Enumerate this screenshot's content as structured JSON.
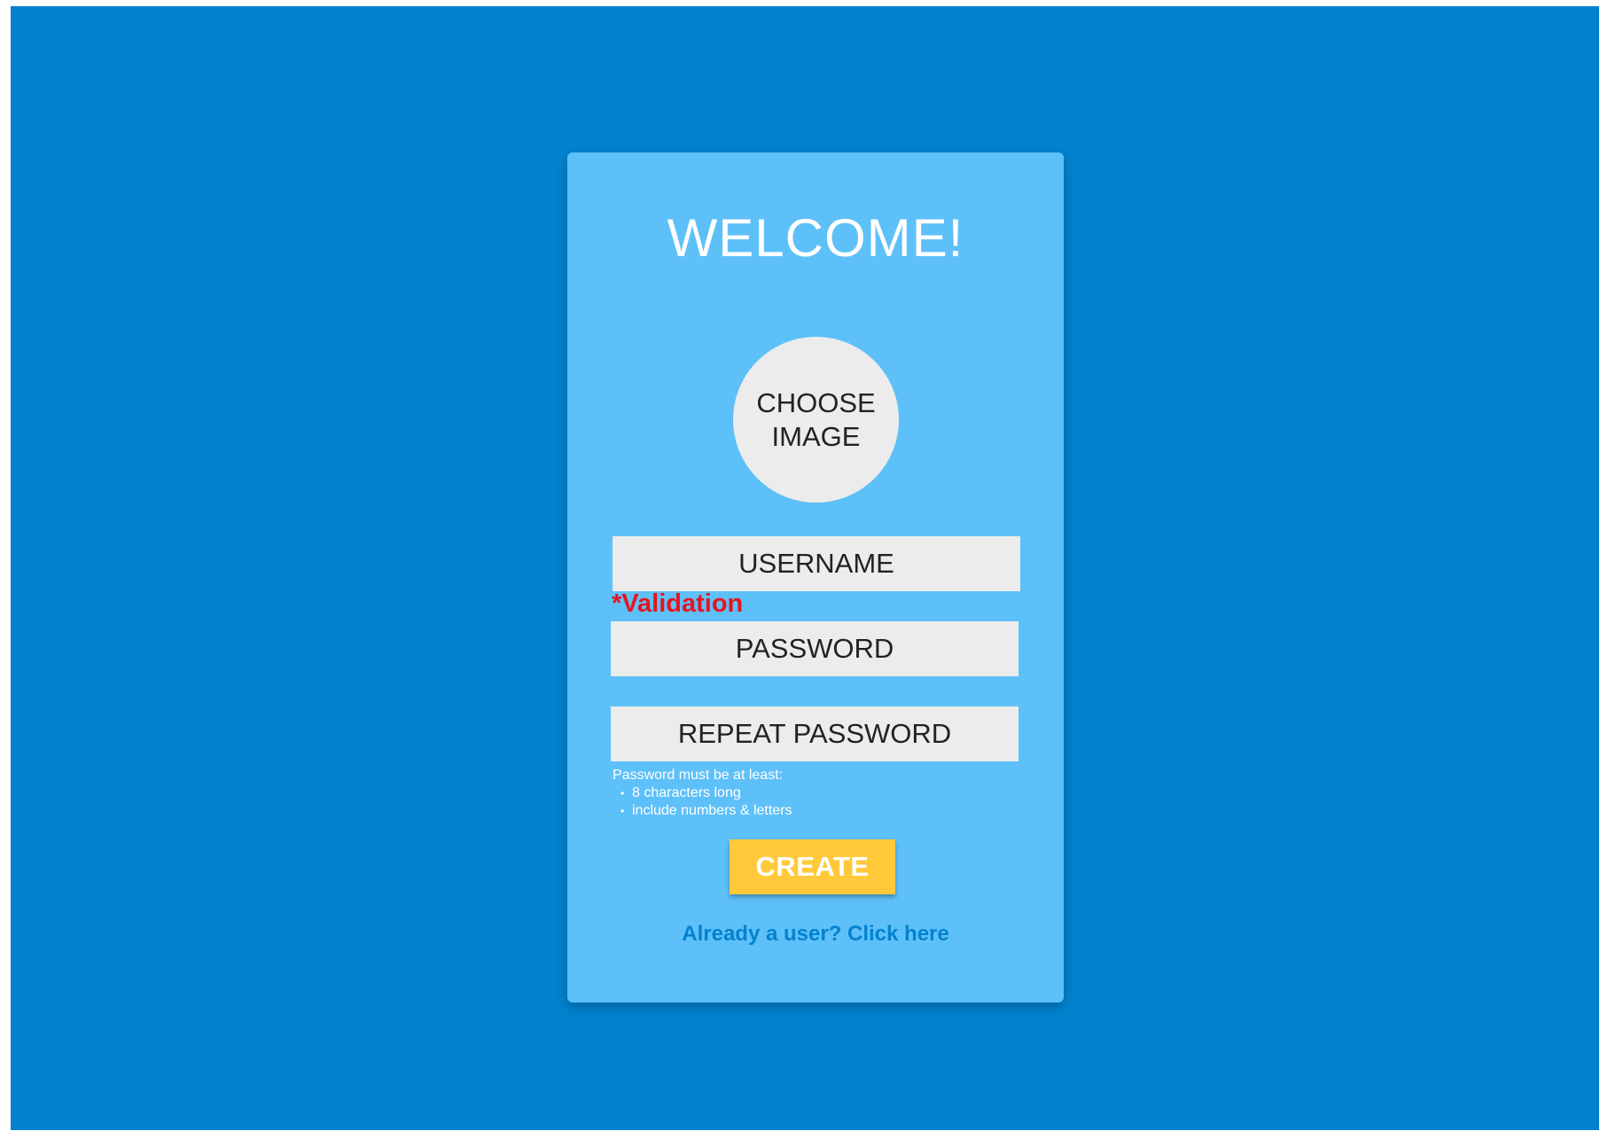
{
  "colors": {
    "background": "#0282CE",
    "card": "#5EC0F8",
    "field": "#ECECEC",
    "validation": "#E8131F",
    "button": "#FFC939",
    "link": "#0282CE"
  },
  "card": {
    "title": "WELCOME!",
    "avatar_label": "CHOOSE\nIMAGE",
    "username_placeholder": "USERNAME",
    "validation_text": "*Validation",
    "password_placeholder": "PASSWORD",
    "repeat_password_placeholder": "REPEAT PASSWORD",
    "password_hint": {
      "intro": "Password must be at least:",
      "rules": [
        "8 characters long",
        "include numbers & letters"
      ]
    },
    "create_label": "CREATE",
    "login_link": "Already a user? Click here"
  }
}
